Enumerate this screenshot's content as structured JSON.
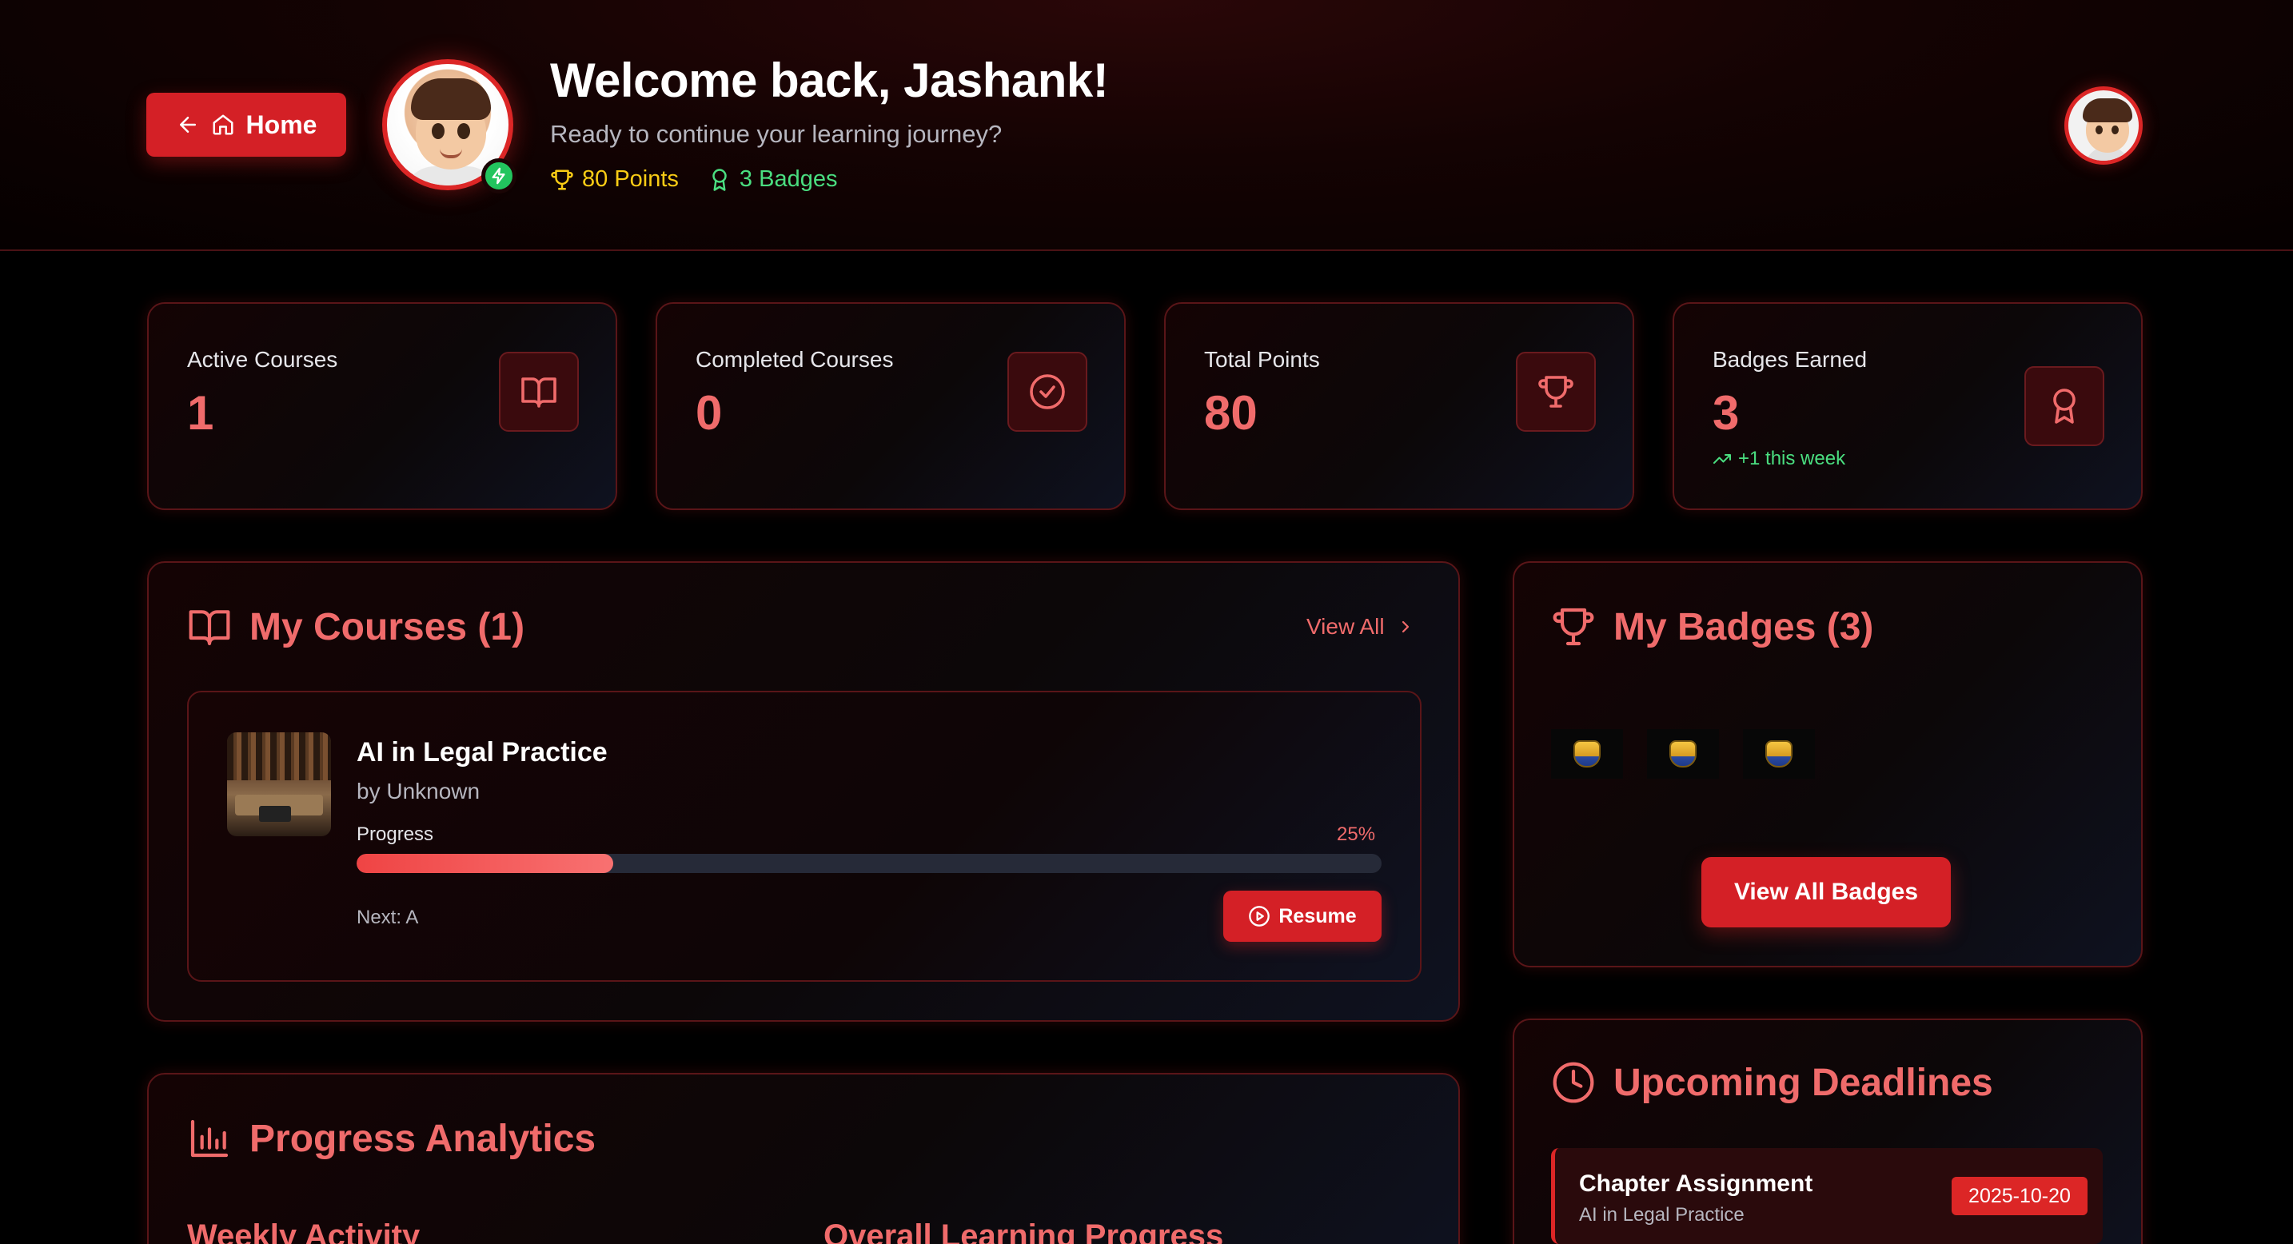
{
  "header": {
    "home_label": "Home",
    "welcome": "Welcome back, Jashank!",
    "subtitle": "Ready to continue your learning journey?",
    "points": "80 Points",
    "badges": "3 Badges"
  },
  "stats": [
    {
      "label": "Active Courses",
      "value": "1",
      "icon": "book-open-icon"
    },
    {
      "label": "Completed Courses",
      "value": "0",
      "icon": "check-circle-icon"
    },
    {
      "label": "Total Points",
      "value": "80",
      "icon": "trophy-icon"
    },
    {
      "label": "Badges Earned",
      "value": "3",
      "extra": "+1 this week",
      "icon": "award-icon"
    }
  ],
  "courses": {
    "title": "My Courses (1)",
    "view_all": "View All",
    "items": [
      {
        "title": "AI in Legal Practice",
        "author": "by Unknown",
        "progress_label": "Progress",
        "progress_pct": "25%",
        "progress_value": 0.25,
        "next": "Next: A",
        "resume_label": "Resume"
      }
    ]
  },
  "badges": {
    "title": "My Badges (3)",
    "count": 3,
    "view_all_label": "View All Badges"
  },
  "analytics": {
    "title": "Progress Analytics",
    "weekly_activity": "Weekly Activity",
    "overall_progress": "Overall Learning Progress"
  },
  "deadlines": {
    "title": "Upcoming Deadlines",
    "items": [
      {
        "title": "Chapter Assignment",
        "course": "AI in Legal Practice",
        "date": "2025-10-20"
      }
    ]
  },
  "colors": {
    "accent": "#dc2626",
    "accent_text": "#f06b6b",
    "points": "#facc15",
    "badges": "#4ade80",
    "background": "#000000"
  }
}
